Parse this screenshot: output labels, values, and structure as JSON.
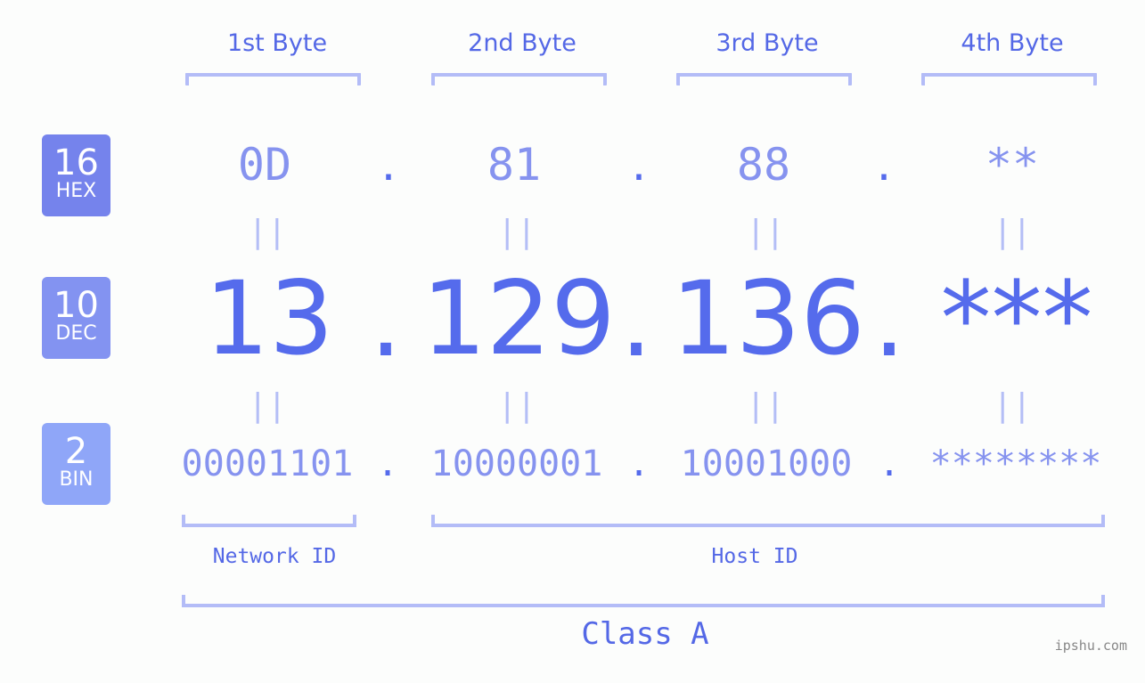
{
  "bytes": [
    {
      "header": "1st Byte",
      "hex": "0D",
      "dec": "13",
      "bin": "00001101"
    },
    {
      "header": "2nd Byte",
      "hex": "81",
      "dec": "129",
      "bin": "10000001"
    },
    {
      "header": "3rd Byte",
      "hex": "88",
      "dec": "136",
      "bin": "10001000"
    },
    {
      "header": "4th Byte",
      "hex": "**",
      "dec": "***",
      "bin": "********"
    }
  ],
  "rows": {
    "hex": {
      "base": "16",
      "label": "HEX",
      "color": "#7583ec"
    },
    "dec": {
      "base": "10",
      "label": "DEC",
      "color": "#8393f1"
    },
    "bin": {
      "base": "2",
      "label": "BIN",
      "color": "#8fa6f8"
    }
  },
  "separator": ".",
  "equals": "||",
  "network_label": "Network ID",
  "host_label": "Host ID",
  "class_label": "Class A",
  "watermark": "ipshu.com"
}
